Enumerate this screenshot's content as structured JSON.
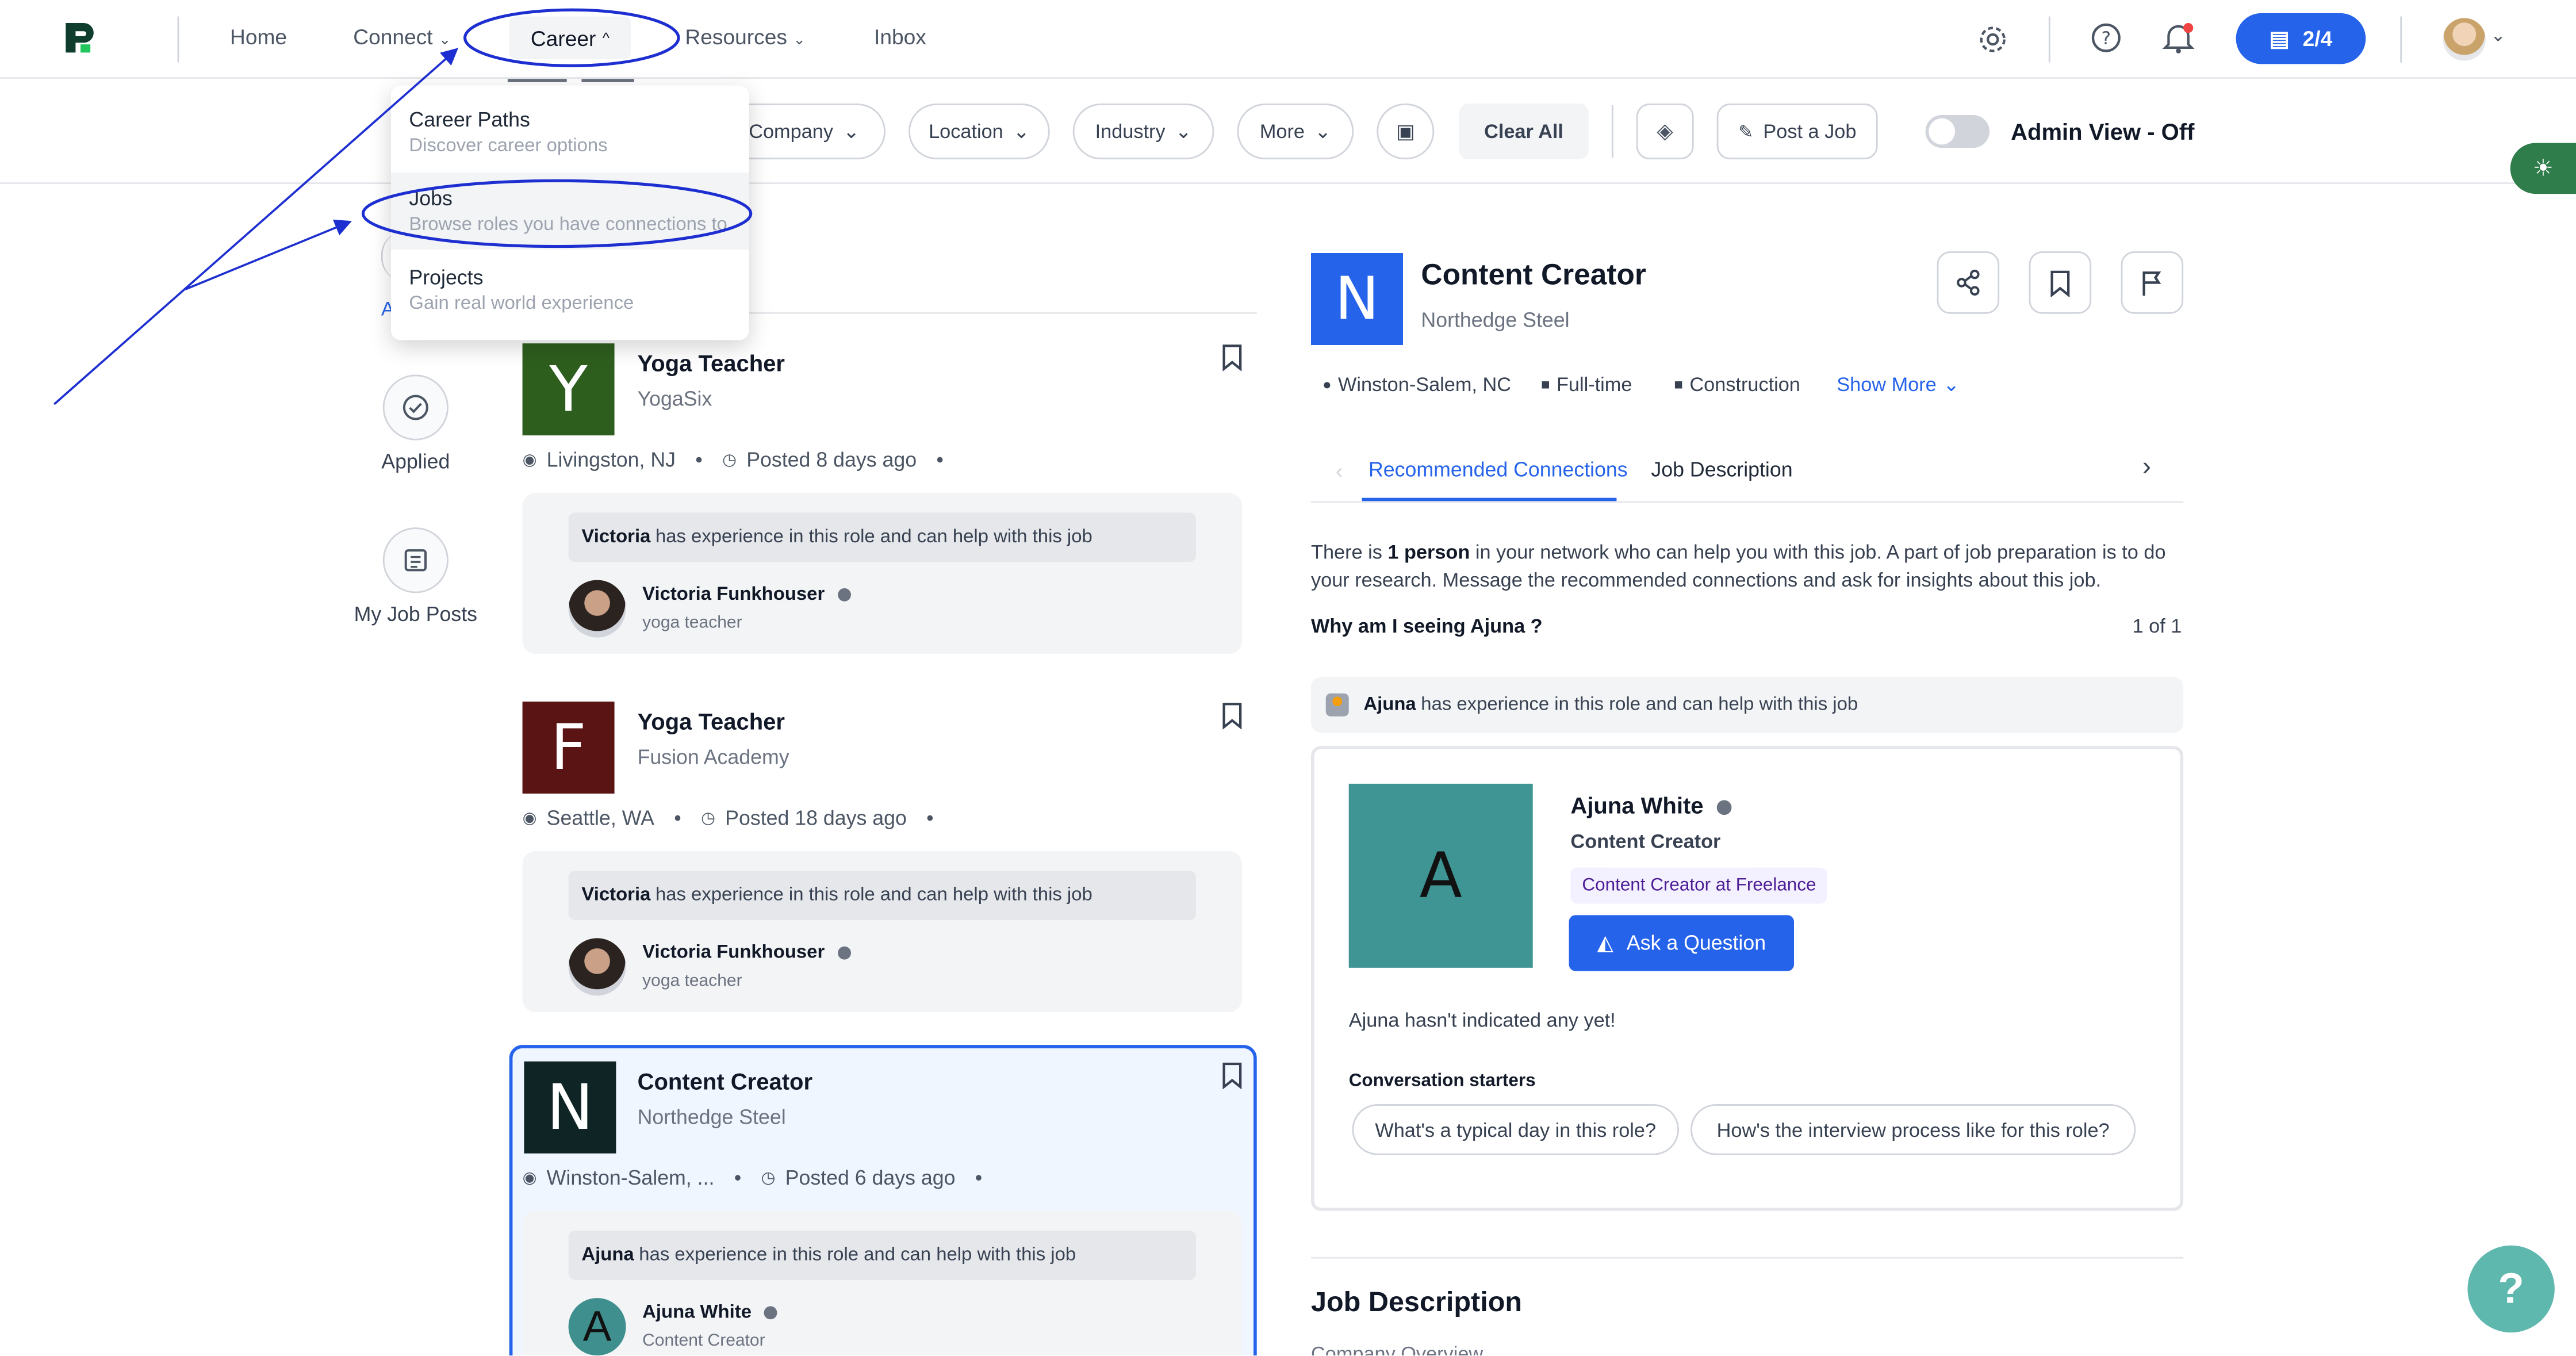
{
  "nav": {
    "home": "Home",
    "connect": "Connect",
    "career": "Career",
    "resources": "Resources",
    "inbox": "Inbox",
    "progress": "2/4",
    "brand_color": "#2563eb"
  },
  "career_menu": [
    {
      "title": "Career Paths",
      "subtitle": "Discover career options"
    },
    {
      "title": "Jobs",
      "subtitle": "Browse roles you have connections to"
    },
    {
      "title": "Projects",
      "subtitle": "Gain real world experience"
    }
  ],
  "filters": {
    "company": "Company",
    "location": "Location",
    "industry": "Industry",
    "more": "More",
    "clear_all": "Clear All",
    "post_job": "Post a Job",
    "admin_view": "Admin View - Off"
  },
  "left_nav": {
    "partial_letter": "A",
    "applied": "Applied",
    "my_job_posts": "My Job Posts"
  },
  "jobs": [
    {
      "letter": "Y",
      "logo_color": "#2e5e1e",
      "title": "Yoga Teacher",
      "company": "YogaSix",
      "location": "Livingston, NJ",
      "posted": "Posted 8 days ago",
      "hint_name": "Victoria",
      "hint_text": "has experience in this role and can help with this job",
      "person": "Victoria Funkhouser",
      "person_role": "yoga teacher"
    },
    {
      "letter": "F",
      "logo_color": "#5b1414",
      "title": "Yoga Teacher",
      "company": "Fusion Academy",
      "location": "Seattle, WA",
      "posted": "Posted 18 days ago",
      "hint_name": "Victoria",
      "hint_text": "has experience in this role and can help with this job",
      "person": "Victoria Funkhouser",
      "person_role": "yoga teacher"
    },
    {
      "letter": "N",
      "logo_color": "#0f2424",
      "title": "Content Creator",
      "company": "Northedge Steel",
      "location": "Winston-Salem, ...",
      "posted": "Posted 6 days ago",
      "hint_name": "Ajuna",
      "hint_text": "has experience in this role and can help with this job",
      "person": "Ajuna White",
      "person_role": "Content Creator"
    }
  ],
  "detail": {
    "letter": "N",
    "title": "Content Creator",
    "company": "Northedge Steel",
    "location": "Winston-Salem, NC",
    "type": "Full-time",
    "industry": "Construction",
    "show_more": "Show More",
    "tab_recommended": "Recommended Connections",
    "tab_description": "Job Description",
    "intro_a": "There is ",
    "intro_count": "1 person",
    "intro_b": " in your network who can help you with this job. A part of job preparation is to do",
    "intro_c": "your research. Message the recommended connections and ask for insights about this job.",
    "why": "Why am I seeing Ajuna ?",
    "pager": "1 of 1",
    "hint_name": "Ajuna",
    "hint_text": "has experience in this role and can help with this job",
    "conn_letter": "A",
    "conn_name": "Ajuna White",
    "conn_role": "Content Creator",
    "conn_badge": "Content Creator at Freelance",
    "ask_button": "Ask a Question",
    "indicated": "Ajuna hasn't indicated any yet!",
    "starters_label": "Conversation starters",
    "starter_1": "What's a typical day in this role?",
    "starter_2": "How's the interview process like for this role?",
    "jd_heading": "Job Description",
    "jd_sub": "Company Overview"
  },
  "help": "?"
}
